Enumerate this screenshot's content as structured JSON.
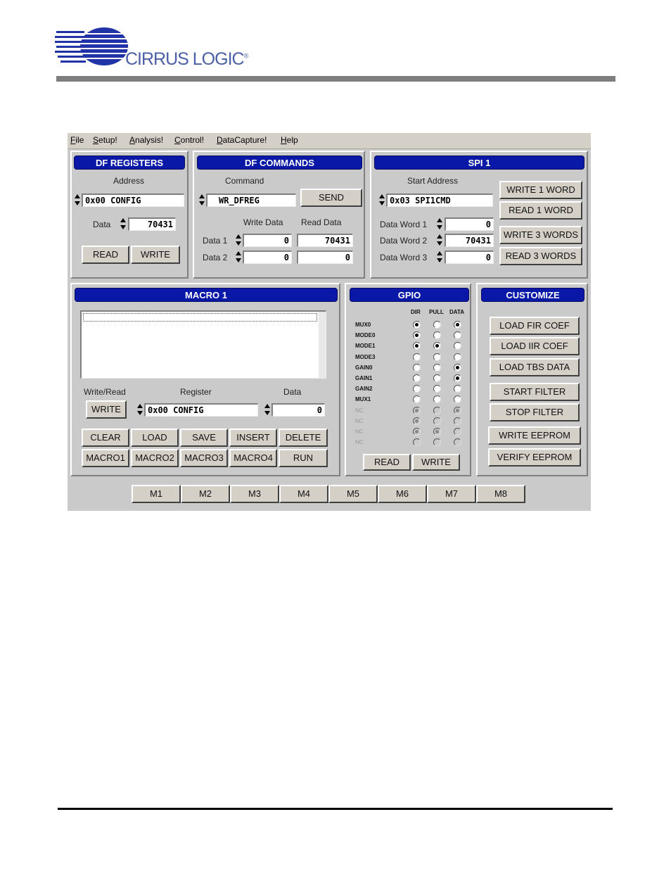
{
  "brand": {
    "name": "CIRRUS LOGIC",
    "trademark": "®",
    "color": "#2233a8"
  },
  "menu": [
    {
      "label": "File",
      "key": "F",
      "rest": "ile"
    },
    {
      "label": "Setup!",
      "key": "S",
      "rest": "etup!"
    },
    {
      "label": "Analysis!",
      "key": "A",
      "rest": "nalysis!"
    },
    {
      "label": "Control!",
      "key": "C",
      "rest": "ontrol!"
    },
    {
      "label": "DataCapture!",
      "key": "D",
      "rest": "ataCapture!"
    },
    {
      "label": "Help",
      "key": "H",
      "rest": "elp"
    }
  ],
  "df_registers": {
    "title": "DF REGISTERS",
    "address_label": "Address",
    "address_value": "0x00  CONFIG",
    "data_label": "Data",
    "data_value": "70431",
    "read": "READ",
    "write": "WRITE"
  },
  "df_commands": {
    "title": "DF COMMANDS",
    "command_label": "Command",
    "command_value": "WR_DFREG",
    "send": "SEND",
    "write_data_label": "Write Data",
    "read_data_label": "Read Data",
    "data1_label": "Data 1",
    "data2_label": "Data 2",
    "data1_write": "0",
    "data1_read": "70431",
    "data2_write": "0",
    "data2_read": "0"
  },
  "spi1": {
    "title": "SPI 1",
    "start_address_label": "Start Address",
    "start_address_value": "0x03  SPI1CMD",
    "word1_label": "Data Word 1",
    "word2_label": "Data Word 2",
    "word3_label": "Data Word 3",
    "word1": "0",
    "word2": "70431",
    "word3": "0",
    "write1": "WRITE 1 WORD",
    "read1": "READ 1 WORD",
    "write3": "WRITE 3 WORDS",
    "read3": "READ 3 WORDS"
  },
  "macro": {
    "title": "MACRO 1",
    "write_read_label": "Write/Read",
    "register_label": "Register",
    "data_label": "Data",
    "mode_button": "WRITE",
    "register_value": "0x00  CONFIG",
    "data_value": "0",
    "buttons": [
      "CLEAR",
      "LOAD",
      "SAVE",
      "INSERT",
      "DELETE"
    ],
    "macros": [
      "MACRO1",
      "MACRO2",
      "MACRO3",
      "MACRO4",
      "RUN"
    ]
  },
  "gpio": {
    "title": "GPIO",
    "headers": [
      "DIR",
      "PULL",
      "DATA"
    ],
    "rows": [
      {
        "name": "MUX0",
        "dir": true,
        "pull": false,
        "data": true,
        "enabled": true
      },
      {
        "name": "MODE0",
        "dir": true,
        "pull": false,
        "data": false,
        "enabled": true
      },
      {
        "name": "MODE1",
        "dir": true,
        "pull": true,
        "data": false,
        "enabled": true
      },
      {
        "name": "MODE3",
        "dir": false,
        "pull": false,
        "data": false,
        "enabled": true
      },
      {
        "name": "GAIN0",
        "dir": false,
        "pull": false,
        "data": true,
        "enabled": true
      },
      {
        "name": "GAIN1",
        "dir": false,
        "pull": false,
        "data": true,
        "enabled": true
      },
      {
        "name": "GAIN2",
        "dir": false,
        "pull": false,
        "data": false,
        "enabled": true
      },
      {
        "name": "MUX1",
        "dir": false,
        "pull": false,
        "data": false,
        "enabled": true
      },
      {
        "name": "NC",
        "dir": true,
        "pull": false,
        "data": true,
        "enabled": false
      },
      {
        "name": "NC",
        "dir": true,
        "pull": false,
        "data": false,
        "enabled": false
      },
      {
        "name": "NC",
        "dir": true,
        "pull": true,
        "data": false,
        "enabled": false
      },
      {
        "name": "NC",
        "dir": false,
        "pull": false,
        "data": false,
        "enabled": false
      }
    ],
    "read": "READ",
    "write": "WRITE"
  },
  "customize": {
    "title": "CUSTOMIZE",
    "buttons": [
      "LOAD FIR COEF",
      "LOAD IIR COEF",
      "LOAD TBS DATA",
      "START FILTER",
      "STOP FILTER",
      "WRITE EEPROM",
      "VERIFY EEPROM"
    ]
  },
  "m_buttons": [
    "M1",
    "M2",
    "M3",
    "M4",
    "M5",
    "M6",
    "M7",
    "M8"
  ]
}
